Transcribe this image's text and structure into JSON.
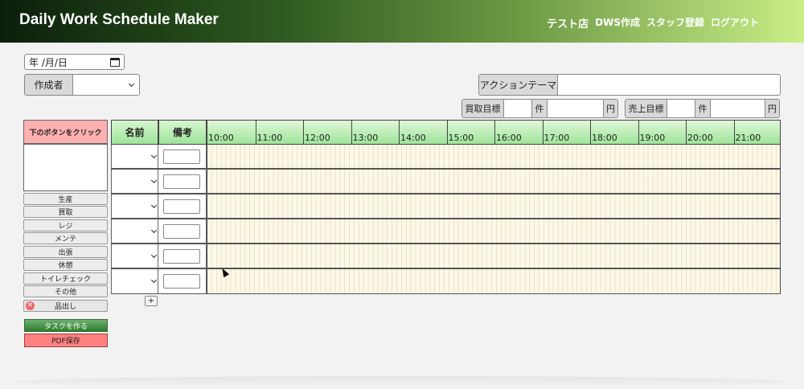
{
  "app": {
    "title": "Daily Work Schedule Maker"
  },
  "nav": {
    "store": "テスト店",
    "items": [
      "DWS作成",
      "スタッフ登録",
      "ログアウト"
    ]
  },
  "form": {
    "date_placeholder": "年 /月/日",
    "author_label": "作成者",
    "author_value": "",
    "action_theme_label": "アクションテーマ",
    "action_theme_value": "",
    "purchase_target_label": "買取目標",
    "sales_target_label": "売上目標",
    "count_unit": "件",
    "yen_unit": "円"
  },
  "palette": {
    "header": "下のボタンをクリック",
    "tasks": [
      "生産",
      "買取",
      "レジ",
      "メンテ",
      "出張",
      "休憩",
      "トイレチェック",
      "その他"
    ],
    "removable_task": "品出し",
    "make_task_button": "タスクを作る",
    "pdf_button": "PDF保存"
  },
  "schedule": {
    "col_name": "名前",
    "col_note": "備考",
    "hours": [
      "10:00",
      "11:00",
      "12:00",
      "13:00",
      "14:00",
      "15:00",
      "16:00",
      "17:00",
      "18:00",
      "19:00",
      "20:00",
      "21:00"
    ],
    "rows": 6,
    "add_row_label": "+"
  },
  "icons": {
    "calendar": "calendar-icon",
    "dropdown": "chevron-down-icon",
    "remove": "close-circle-icon",
    "cursor": "mouse-pointer-icon"
  },
  "colors": {
    "header_green_dark": "#0b1f0b",
    "header_green_light": "#c9ee88",
    "grid_bg": "#fcf8e6",
    "palette_head": "#ffb0b0",
    "make_task": "#2d7d2d",
    "pdf": "#ff8080"
  }
}
